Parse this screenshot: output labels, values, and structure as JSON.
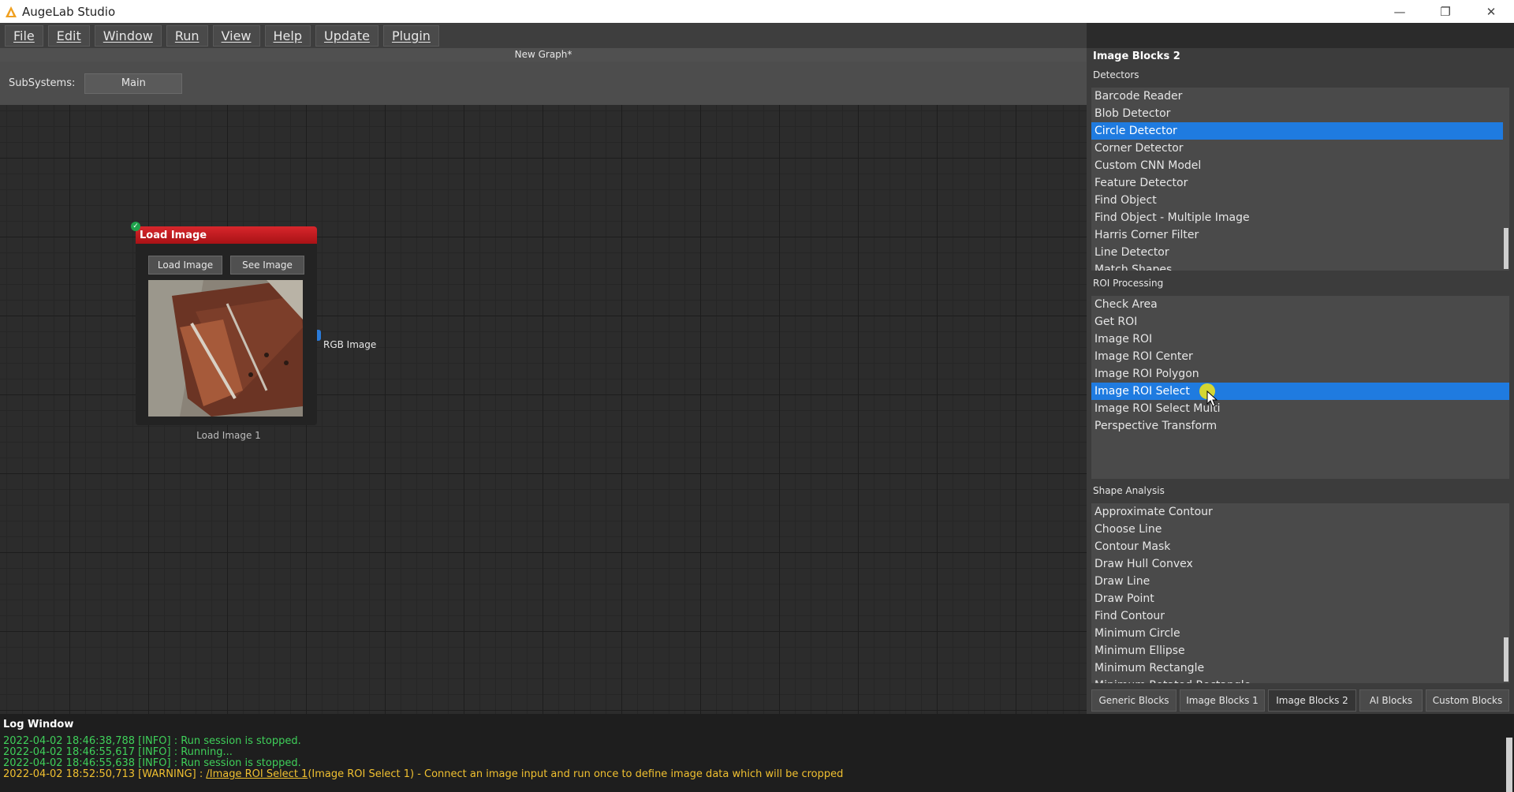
{
  "app": {
    "title": "AugeLab Studio"
  },
  "window_controls": {
    "minimize": "—",
    "maximize": "❐",
    "close": "✕"
  },
  "menu": [
    "File",
    "Edit",
    "Window",
    "Run",
    "View",
    "Help",
    "Update",
    "Plugin"
  ],
  "graph": {
    "title": "New Graph*"
  },
  "subsystems": {
    "label": "SubSystems:",
    "main": "Main"
  },
  "node": {
    "title": "Load Image",
    "load_button": "Load Image",
    "see_button": "See Image",
    "caption": "Load Image 1",
    "output_label": "RGB Image"
  },
  "panel": {
    "title": "Image Blocks 2",
    "detectors": {
      "title": "Detectors",
      "items": [
        "Barcode Reader",
        "Blob Detector",
        "Circle Detector",
        "Corner Detector",
        "Custom CNN Model",
        "Feature Detector",
        "Find Object",
        "Find Object - Multiple Image",
        "Harris Corner Filter",
        "Line Detector",
        "Match Shapes"
      ],
      "selected": "Circle Detector"
    },
    "roi": {
      "title": "ROI Processing",
      "items": [
        "Check Area",
        "Get ROI",
        "Image ROI",
        "Image ROI Center",
        "Image ROI Polygon",
        "Image ROI Select",
        "Image ROI Select Multi",
        "Perspective Transform"
      ],
      "selected": "Image ROI Select"
    },
    "shape": {
      "title": "Shape Analysis",
      "items": [
        "Approximate Contour",
        "Choose Line",
        "Contour Mask",
        "Draw Hull Convex",
        "Draw Line",
        "Draw Point",
        "Find Contour",
        "Minimum Circle",
        "Minimum Ellipse",
        "Minimum Rectangle",
        "Minimum Rotated Rectangle"
      ]
    },
    "tabs": [
      "Generic Blocks",
      "Image Blocks 1",
      "Image Blocks 2",
      "AI Blocks",
      "Custom Blocks"
    ],
    "active_tab": "Image Blocks 2"
  },
  "log": {
    "title": "Log Window",
    "lines": [
      "2022-04-02 18:46:38,788 [INFO] : Run session is stopped.",
      "2022-04-02 18:46:55,617 [INFO] : Running...",
      "2022-04-02 18:46:55,638 [INFO] : Run session is stopped."
    ],
    "warning": {
      "prefix": "2022-04-02 18:52:50,713 [WARNING] : ",
      "link": "/Image ROI Select 1",
      "suffix": "(Image ROI Select 1) - Connect an image input and run once to define image data which will be cropped"
    }
  },
  "colors": {
    "accent": "#1f7be0",
    "node_header": "#c41a20",
    "log_info": "#3fd05a",
    "log_warning": "#f0c030"
  }
}
